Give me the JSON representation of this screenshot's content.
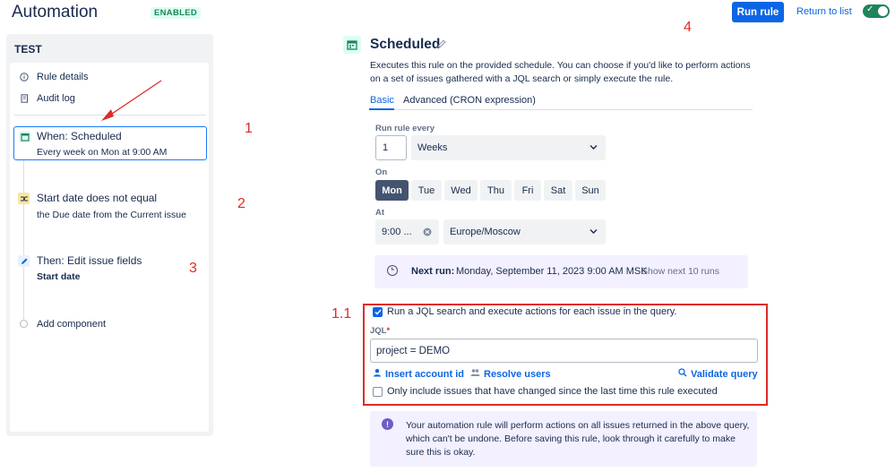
{
  "header": {
    "title": "Automation",
    "status_badge": "ENABLED",
    "run_rule_label": "Run rule",
    "return_label": "Return to list",
    "toggle_on": true
  },
  "sidebar": {
    "title": "TEST",
    "links": [
      {
        "label": "Rule details",
        "icon": "info-icon"
      },
      {
        "label": "Audit log",
        "icon": "document-icon"
      }
    ],
    "components": [
      {
        "title": "When: Scheduled",
        "subtitle": "Every week on Mon at 9:00 AM",
        "icon": "calendar-icon",
        "color": "#1f845a",
        "selected": true
      },
      {
        "title": "Start date does not equal",
        "subtitle": "the Due date from the Current issue",
        "icon": "shuffle-icon",
        "color": "#f5cd47",
        "selected": false
      },
      {
        "title": "Then: Edit issue fields",
        "subtitle": "Start date",
        "icon": "pencil-icon",
        "color": "#0c66e4",
        "selected": false
      }
    ],
    "add_component": "Add component"
  },
  "annotations": {
    "n1": "1",
    "n2": "2",
    "n3": "3",
    "n4": "4",
    "n11": "1.1"
  },
  "main": {
    "title": "Scheduled",
    "description": "Executes this rule on the provided schedule. You can choose if you'd like to perform actions on a set of issues gathered with a JQL search or simply execute the rule.",
    "tabs": [
      "Basic",
      "Advanced (CRON expression)"
    ],
    "active_tab": "Basic",
    "run_every_label": "Run rule every",
    "run_every_value": "1",
    "run_every_unit": "Weeks",
    "on_label": "On",
    "days": [
      "Mon",
      "Tue",
      "Wed",
      "Thu",
      "Fri",
      "Sat",
      "Sun"
    ],
    "selected_day": "Mon",
    "at_label": "At",
    "time_value": "9:00 ...",
    "timezone": "Europe/Moscow",
    "next_run_label": "Next run:",
    "next_run_value": "Monday, September 11, 2023 9:00 AM MSK",
    "show_next_label": "Show next 10 runs",
    "jql_option": "Run a JQL search and execute actions for each issue in the query.",
    "jql_option_checked": true,
    "jql_label": "JQL",
    "jql_required_mark": "*",
    "jql_value": "project = DEMO",
    "insert_account_label": "Insert account id",
    "resolve_users_label": "Resolve users",
    "validate_query_label": "Validate query",
    "only_changed_option": "Only include issues that have changed since the last time this rule executed",
    "only_changed_checked": false,
    "warning": "Your automation rule will perform actions on all issues returned in the above query, which can't be undone. Before saving this rule, look through it carefully to make sure this is okay."
  }
}
